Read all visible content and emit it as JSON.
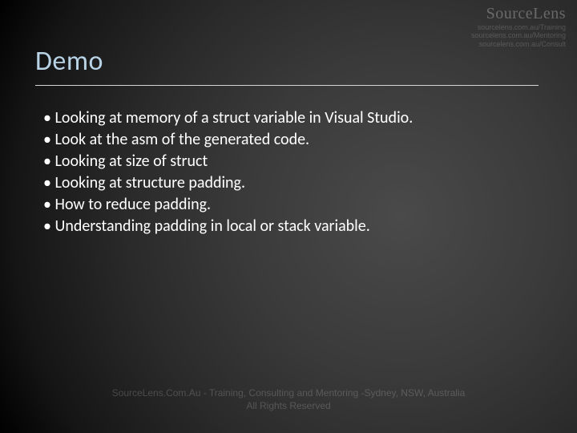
{
  "watermark": {
    "brand": "SourceLens",
    "lines": [
      "sourcelens.com.au/Training",
      "sourcelens.com.au/Mentoring",
      "sourcelens.com.au/Consult"
    ]
  },
  "title": "Demo",
  "bullets": [
    "Looking at memory of a struct variable in Visual Studio.",
    "Look at the asm of the generated code.",
    "Looking at size of struct",
    "Looking at structure padding.",
    "How to reduce padding.",
    "Understanding padding in local or stack variable."
  ],
  "footer": {
    "line1": "SourceLens.Com.Au - Training, Consulting and Mentoring -Sydney, NSW, Australia",
    "line2": "All Rights Reserved"
  }
}
